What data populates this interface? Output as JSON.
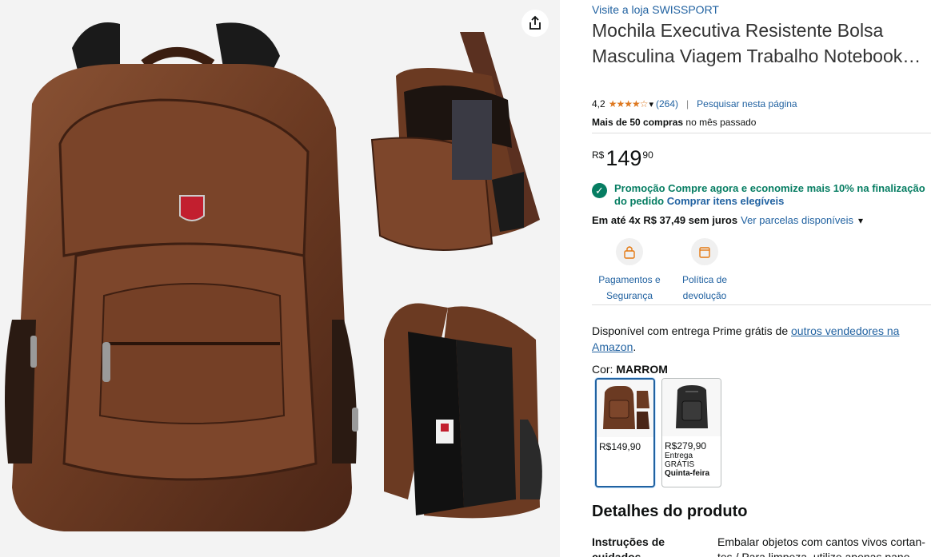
{
  "store_link": "Visite a loja SWISSPORT",
  "title": "Mochila Executiva Resistente Bolsa Masculina Viagem Trabalho Notebook…",
  "rating": {
    "value": "4,2",
    "stars": 4.2,
    "count": "(264)",
    "search_link": "Pesquisar nesta página"
  },
  "purchases": {
    "bold": "Mais de 50 compras",
    "rest": "no mês passado"
  },
  "price": {
    "currency": "R$",
    "whole": "149",
    "fraction": "90"
  },
  "promo": {
    "text": "Promoção Compre agora e economize mais 10% na finalização do pedido",
    "link": "Comprar itens elegíveis"
  },
  "installments": {
    "bold": "Em até 4x R$ 37,49 sem juros",
    "link": "Ver parcelas disponíveis"
  },
  "badges": [
    {
      "line1": "Pagamentos e",
      "line2": "Segurança",
      "icon": "lock-icon"
    },
    {
      "line1": "Política de",
      "line2": "devolução",
      "icon": "return-icon"
    }
  ],
  "availability": {
    "text": "Disponível com entrega Prime grátis de",
    "link": "outros vendedores na Amazon",
    "suffix": "."
  },
  "color": {
    "label": "Cor:",
    "value": "MARROM"
  },
  "swatches": [
    {
      "price": "R$149,90",
      "selected": true,
      "color": "#6b3a22"
    },
    {
      "price": "R$279,90",
      "line1": "Entrega",
      "line2": "GRÁTIS",
      "line3": "Quinta-feira",
      "selected": false,
      "color": "#2b2b2b"
    }
  ],
  "details": {
    "heading": "Detalhes do produto",
    "row_key": "Instruções de cuidados",
    "row_value": "Embalar objetos com cantos vivos cortan-tes / Para limpeza, utilize apenas pano"
  },
  "colors": {
    "link": "#2162a1",
    "green": "#067d62",
    "star": "#de7921",
    "leather": "#6b3a22"
  }
}
